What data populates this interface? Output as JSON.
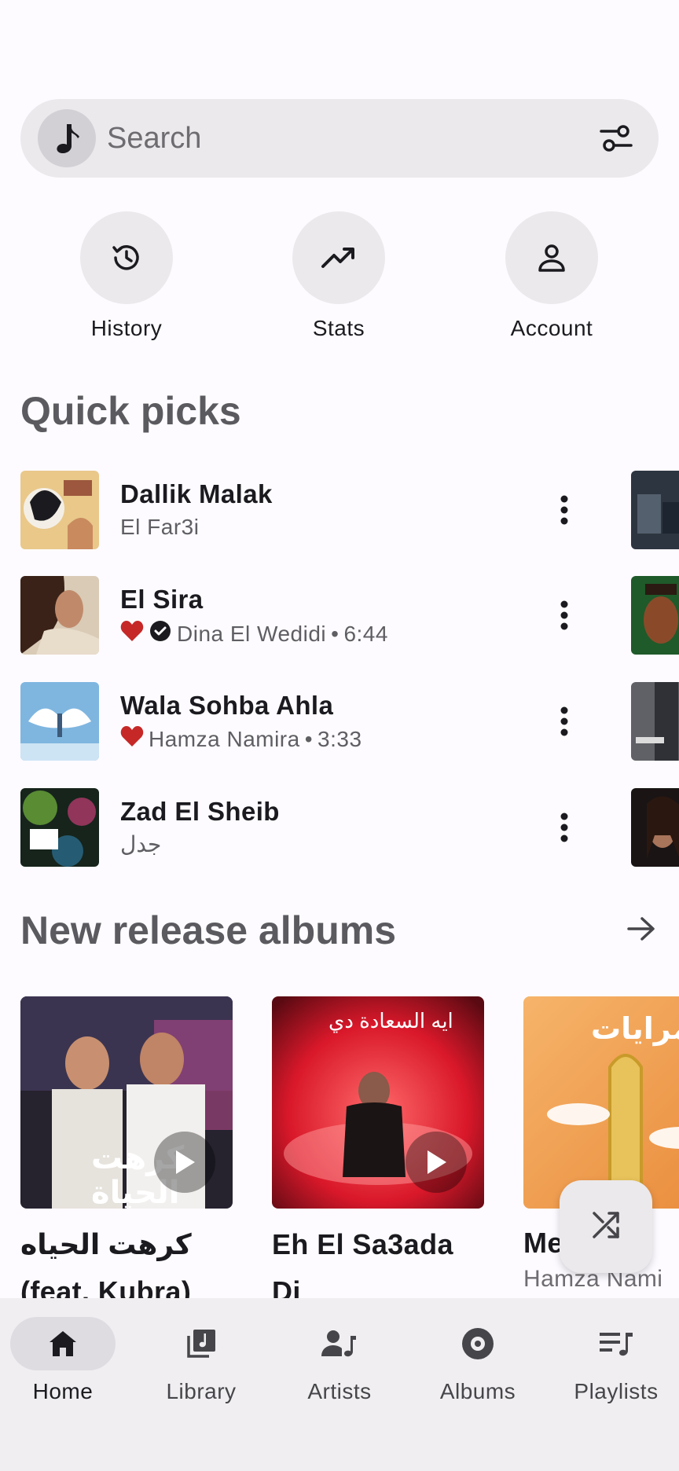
{
  "search": {
    "placeholder": "Search",
    "logo_icon": "music-note-icon",
    "filter_icon": "tune-icon"
  },
  "shortcuts": [
    {
      "label": "History",
      "icon": "history-icon"
    },
    {
      "label": "Stats",
      "icon": "trending-up-icon"
    },
    {
      "label": "Account",
      "icon": "person-icon"
    }
  ],
  "quick_picks": {
    "title": "Quick picks",
    "items": [
      {
        "title": "Dallik Malak",
        "artist": "El Far3i",
        "duration": "",
        "liked": false,
        "verified": false
      },
      {
        "title": "El Sira",
        "artist": "Dina El Wedidi",
        "duration": "6:44",
        "liked": true,
        "verified": true
      },
      {
        "title": "Wala Sohba Ahla",
        "artist": "Hamza Namira",
        "duration": "3:33",
        "liked": true,
        "verified": false
      },
      {
        "title": "Zad El Sheib",
        "artist": "جدل",
        "duration": "",
        "liked": false,
        "verified": false
      }
    ],
    "separator": "•"
  },
  "new_releases": {
    "title": "New release albums",
    "albums": [
      {
        "title_line1": "كرهت الحياه",
        "title_line2": "(feat. Kubra)",
        "subtitle": "",
        "cover_text": "كرهت الحياة"
      },
      {
        "title_line1": "Eh El Sa3ada",
        "title_line2": "Di",
        "subtitle": "",
        "cover_text": "ايه السعادة دي"
      },
      {
        "title_line1": "Me",
        "title_line2": "",
        "subtitle": "Hamza Nami",
        "cover_text": "مرايات"
      }
    ]
  },
  "nav": {
    "items": [
      {
        "label": "Home",
        "icon": "home-icon",
        "active": true
      },
      {
        "label": "Library",
        "icon": "library-music-icon",
        "active": false
      },
      {
        "label": "Artists",
        "icon": "artist-icon",
        "active": false
      },
      {
        "label": "Albums",
        "icon": "album-icon",
        "active": false
      },
      {
        "label": "Playlists",
        "icon": "playlist-icon",
        "active": false
      }
    ]
  },
  "colors": {
    "background": "#fdfbff",
    "surface": "#ebe9ec",
    "heart": "#c62828",
    "section_title": "#5b5b5f"
  }
}
